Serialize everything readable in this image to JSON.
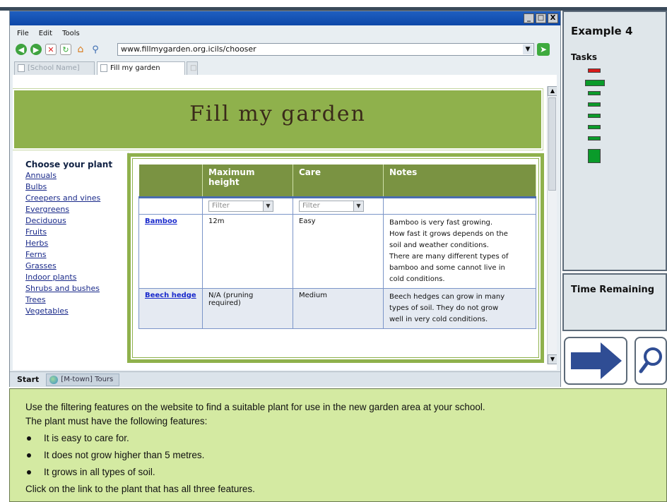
{
  "browser": {
    "menu": [
      "File",
      "Edit",
      "Tools"
    ],
    "address": "www.fillmygarden.org.icils/chooser",
    "tabs": [
      "[School Name]",
      "Fill my garden"
    ],
    "window_buttons": [
      "_",
      "□",
      "X"
    ]
  },
  "site": {
    "banner_title": "Fill my garden",
    "sidebar": {
      "heading": "Choose your plant",
      "links": [
        "Annuals",
        "Bulbs",
        "Creepers and vines",
        "Evergreens",
        "Deciduous",
        "Fruits",
        "Herbs",
        "Ferns",
        "Grasses",
        "Indoor plants",
        "Shrubs and bushes",
        "Trees",
        "Vegetables"
      ]
    },
    "table": {
      "headers": [
        "",
        "Maximum height",
        "Care",
        "Notes"
      ],
      "filter_placeholder": "Filter",
      "rows": [
        {
          "name": "Bamboo",
          "height": "12m",
          "care": "Easy",
          "notes": [
            "Bamboo is very fast growing.",
            "How fast it grows depends on the",
            "soil and weather conditions.",
            "There are many different types of",
            "bamboo and some cannot live in",
            "cold conditions."
          ]
        },
        {
          "name": "Beech hedge",
          "height": "N/A (pruning required)",
          "care": "Medium",
          "notes": [
            "Beech hedges can grow in many",
            "types of soil. They do not grow",
            "well in very cold conditions."
          ]
        }
      ]
    }
  },
  "taskbar": {
    "start": "Start",
    "item": "[M-town] Tours"
  },
  "right_panel": {
    "example_title": "Example 4",
    "tasks_label": "Tasks",
    "time_label": "Time Remaining",
    "colors": {
      "done": "#0a9b2a",
      "current": "#d81a1a"
    }
  },
  "instructions": {
    "line1": "Use the filtering features on the website to find a suitable plant for use in the new garden area at your school.",
    "line2": "The plant must have the following features:",
    "bullets": [
      "It is easy to care for.",
      "It does not grow higher than 5 metres.",
      "It grows in all types of soil."
    ],
    "closing": "Click on the link to the plant that has all three features."
  }
}
